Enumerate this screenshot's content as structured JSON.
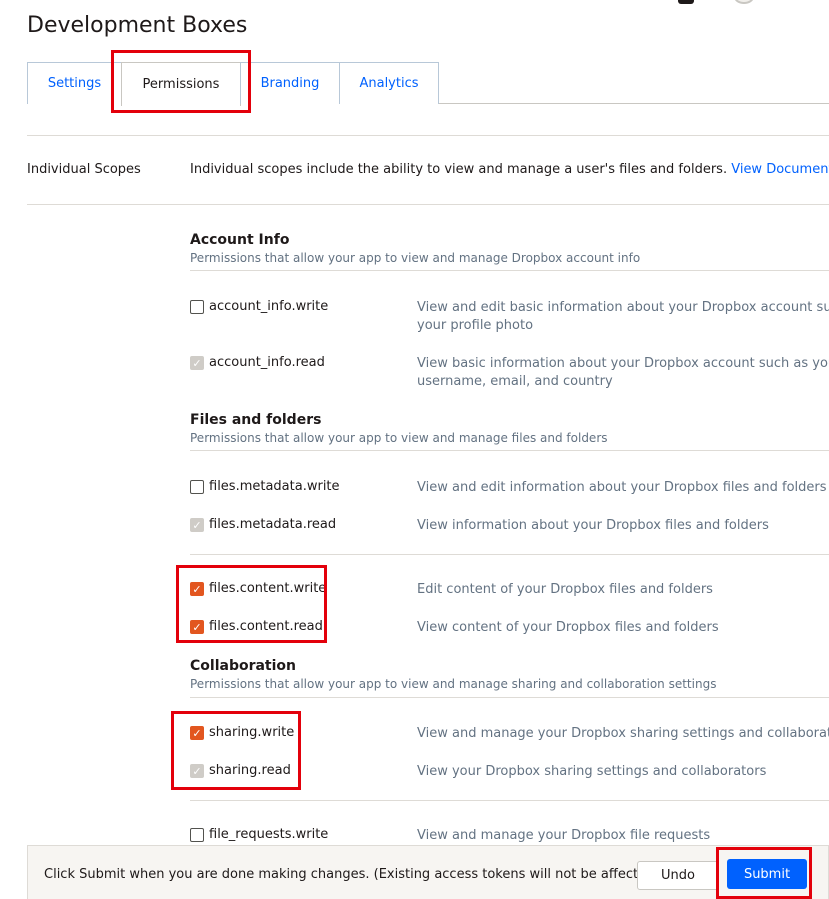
{
  "page_title": "Development Boxes",
  "tabs": [
    {
      "label": "Settings"
    },
    {
      "label": "Permissions"
    },
    {
      "label": "Branding"
    },
    {
      "label": "Analytics"
    }
  ],
  "active_tab": "Permissions",
  "individual_scopes": {
    "label": "Individual Scopes",
    "description": "Individual scopes include the ability to view and manage a user's files and folders.",
    "link": "View Documentation"
  },
  "sections": {
    "account_info": {
      "title": "Account Info",
      "subtitle": "Permissions that allow your app to view and manage Dropbox account info",
      "perms": [
        {
          "name": "account_info.write",
          "desc1": "View and edit basic information about your Dropbox account such a",
          "desc2": "your profile photo",
          "state": "unchecked"
        },
        {
          "name": "account_info.read",
          "desc1": "View basic information about your Dropbox account such as your",
          "desc2": "username, email, and country",
          "state": "checked-disabled"
        }
      ]
    },
    "files": {
      "title": "Files and folders",
      "subtitle": "Permissions that allow your app to view and manage files and folders",
      "perms": [
        {
          "name": "files.metadata.write",
          "desc1": "View and edit information about your Dropbox files and folders",
          "state": "unchecked"
        },
        {
          "name": "files.metadata.read",
          "desc1": "View information about your Dropbox files and folders",
          "state": "checked-disabled"
        },
        {
          "name": "files.content.write",
          "desc1": "Edit content of your Dropbox files and folders",
          "state": "checked"
        },
        {
          "name": "files.content.read",
          "desc1": "View content of your Dropbox files and folders",
          "state": "checked"
        }
      ]
    },
    "collaboration": {
      "title": "Collaboration",
      "subtitle": "Permissions that allow your app to view and manage sharing and collaboration settings",
      "perms": [
        {
          "name": "sharing.write",
          "desc1": "View and manage your Dropbox sharing settings and collaborators",
          "state": "checked"
        },
        {
          "name": "sharing.read",
          "desc1": "View your Dropbox sharing settings and collaborators",
          "state": "checked-disabled"
        },
        {
          "name": "file_requests.write",
          "desc1": "View and manage your Dropbox file requests",
          "state": "unchecked"
        }
      ]
    }
  },
  "footer": {
    "message": "Click Submit when you are done making changes. (Existing access tokens will not be affected)",
    "undo_label": "Undo",
    "submit_label": "Submit"
  },
  "colors": {
    "accent_blue": "#0061fe",
    "checkbox_orange": "#e2561f",
    "highlight_red": "#e3000b"
  }
}
